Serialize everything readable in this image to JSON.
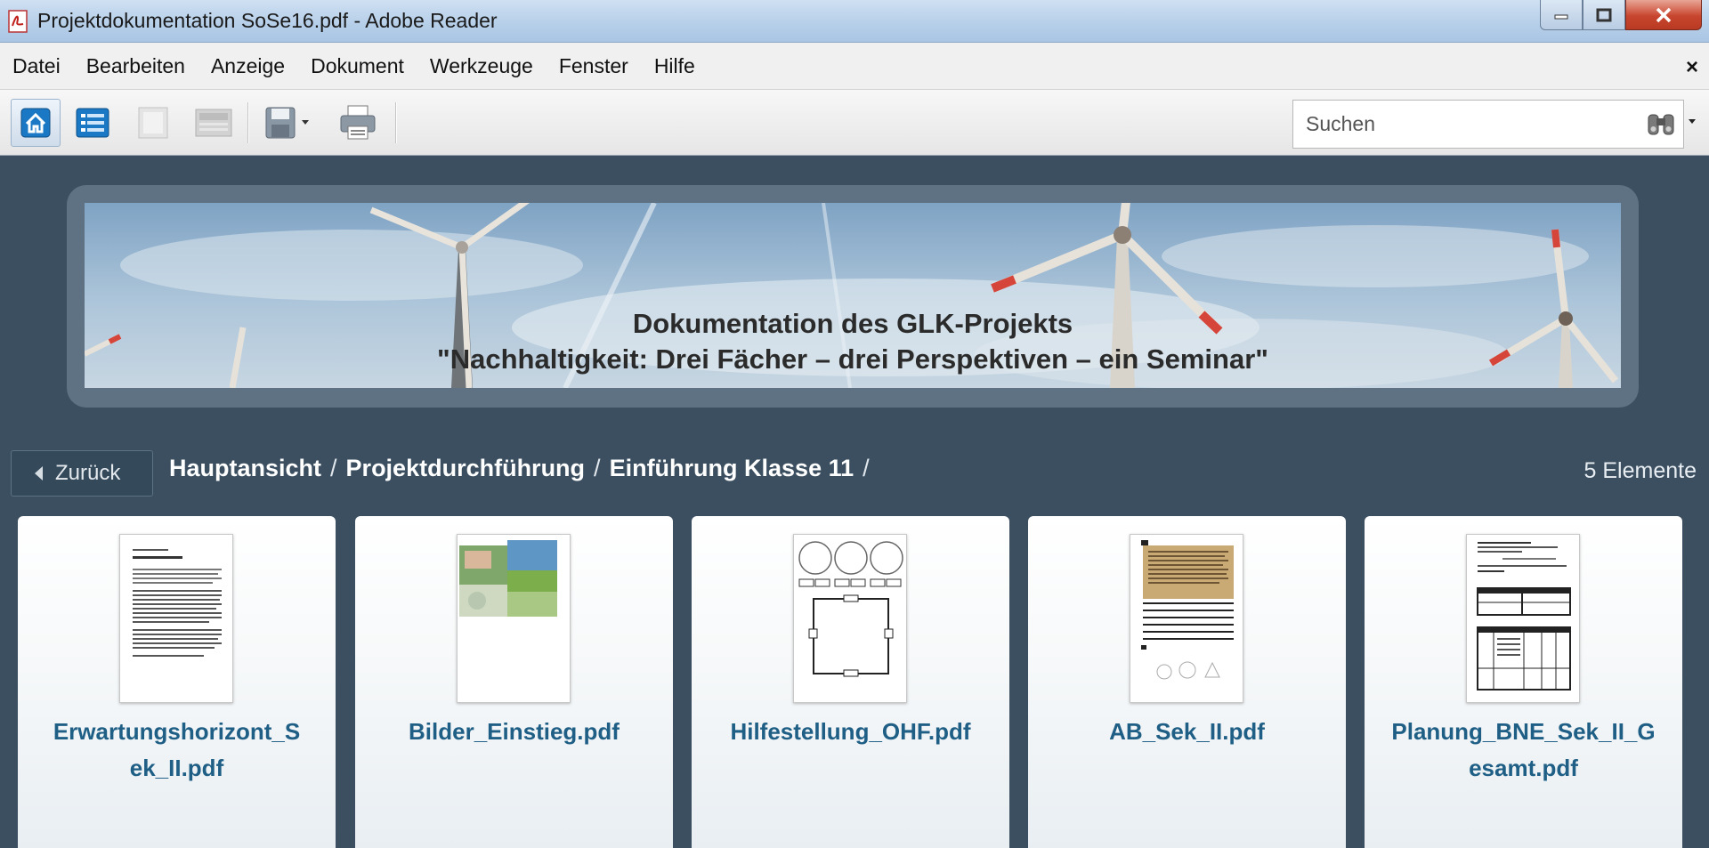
{
  "window": {
    "title": "Projektdokumentation SoSe16.pdf - Adobe Reader"
  },
  "menu": {
    "items": [
      "Datei",
      "Bearbeiten",
      "Anzeige",
      "Dokument",
      "Werkzeuge",
      "Fenster",
      "Hilfe"
    ],
    "close_glyph": "×"
  },
  "toolbar": {
    "icons": [
      "home-icon",
      "list-view-icon",
      "page-icon",
      "layout-icon",
      "save-icon",
      "print-icon"
    ],
    "search_placeholder": "Suchen"
  },
  "banner": {
    "line1": "Dokumentation des GLK-Projekts",
    "line2": "\"Nachhaltigkeit: Drei Fächer – drei Perspektiven – ein Seminar\""
  },
  "navigation": {
    "back_label": "Zurück",
    "breadcrumbs": [
      "Hauptansicht",
      "Projektdurchführung",
      "Einführung Klasse 11"
    ],
    "separator": "/",
    "item_count": "5 Elemente"
  },
  "files": [
    {
      "name": "Erwartungshorizont_Sek_II.pdf",
      "display": "Erwartungshorizont_S\nek_II.pdf",
      "thumb": "text-page"
    },
    {
      "name": "Bilder_Einstieg.pdf",
      "display": "Bilder_Einstieg.pdf",
      "thumb": "photo-page"
    },
    {
      "name": "Hilfestellung_OHF.pdf",
      "display": "Hilfestellung_OHF.pdf",
      "thumb": "diagram-page"
    },
    {
      "name": "AB_Sek_II.pdf",
      "display": "AB_Sek_II.pdf",
      "thumb": "worksheet-page"
    },
    {
      "name": "Planung_BNE_Sek_II_Gesamt.pdf",
      "display": "Planung_BNE_Sek_II_G\nesamt.pdf",
      "thumb": "table-page"
    }
  ],
  "colors": {
    "background": "#3b4f60",
    "file_link": "#1f5f86",
    "close_button": "#c8452e"
  }
}
